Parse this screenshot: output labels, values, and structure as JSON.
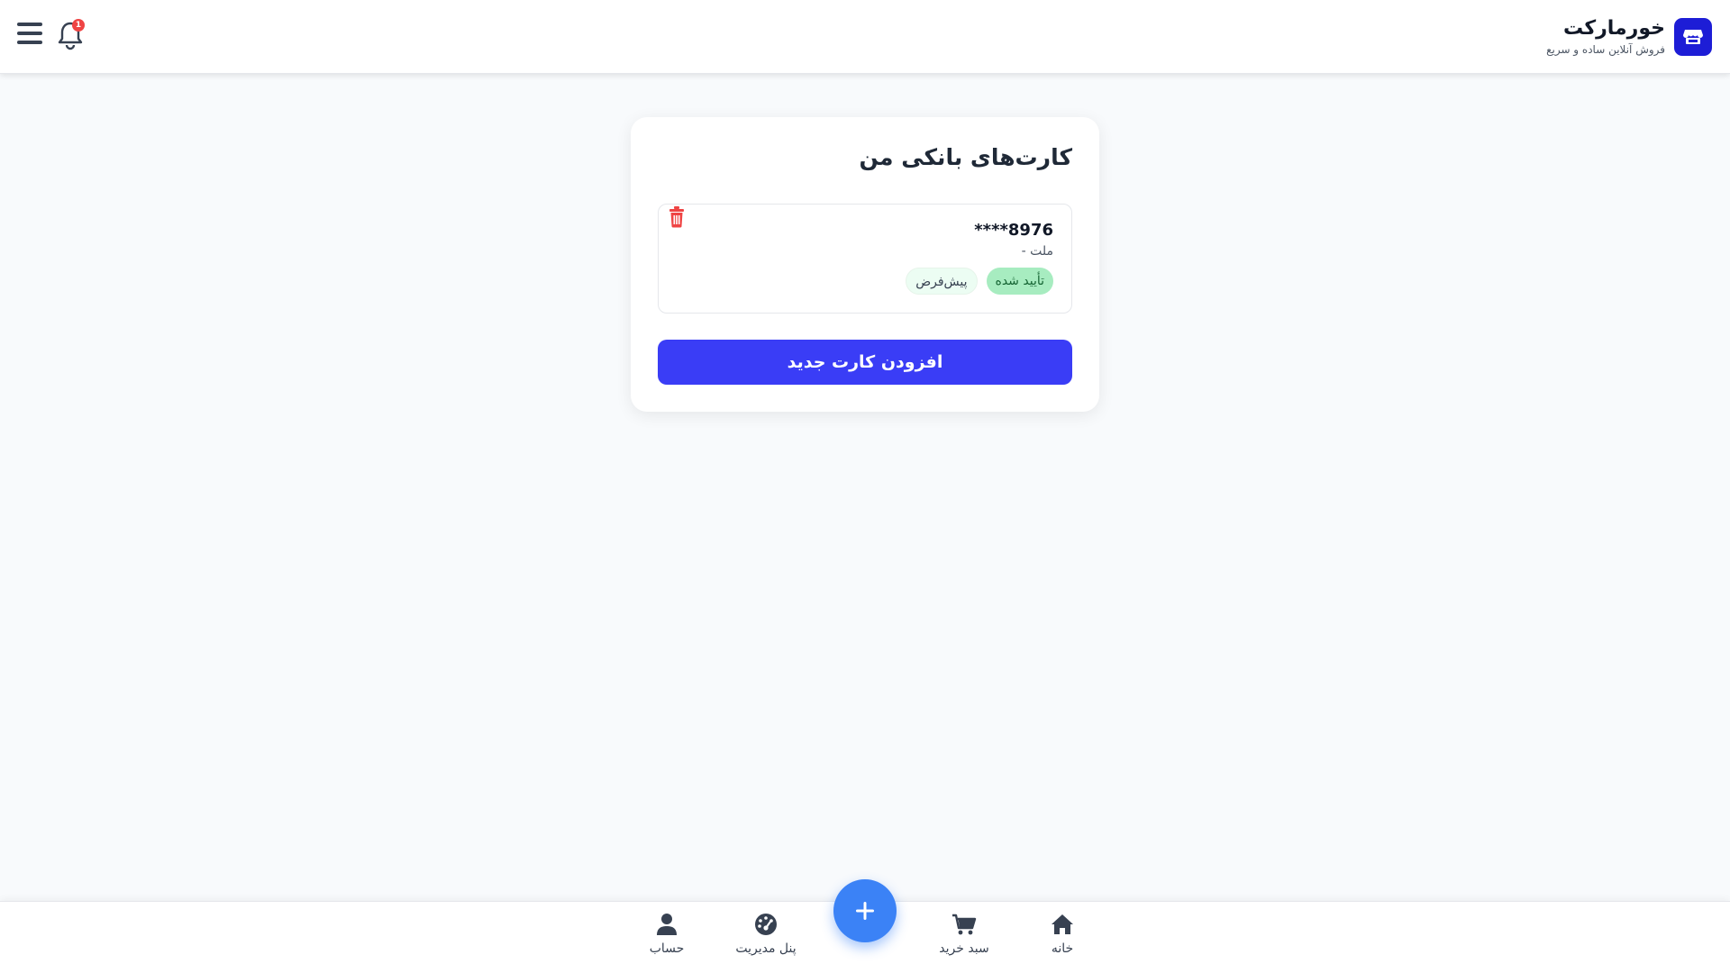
{
  "header": {
    "brand_title": "خورمارکت",
    "brand_subtitle": "فروش آنلاین ساده و سریع",
    "notification_count": "1",
    "icons": [
      "store-icon",
      "bell-icon",
      "menu-icon"
    ]
  },
  "panel": {
    "title": "کارت‌های بانکی من",
    "cards": [
      {
        "number": "****8976",
        "bank": "ملت -",
        "tags": [
          "تأیید شده",
          "پیش‌فرض"
        ]
      }
    ],
    "add_button_label": "افزودن کارت جدید"
  },
  "bottom_nav": {
    "items": [
      {
        "label": "خانه",
        "icon": "home-icon"
      },
      {
        "label": "سبد خرید",
        "icon": "cart-icon"
      },
      {
        "label": "پنل مدیریت",
        "icon": "dashboard-icon"
      },
      {
        "label": "حساب",
        "icon": "user-icon"
      }
    ],
    "fab_icon": "plus-icon"
  },
  "colors": {
    "primary": "#3a3df6",
    "brand": "#1d1dd6",
    "fab": "#3b82f6",
    "verified_bg": "#a7ecc0",
    "danger": "#ef4444"
  }
}
